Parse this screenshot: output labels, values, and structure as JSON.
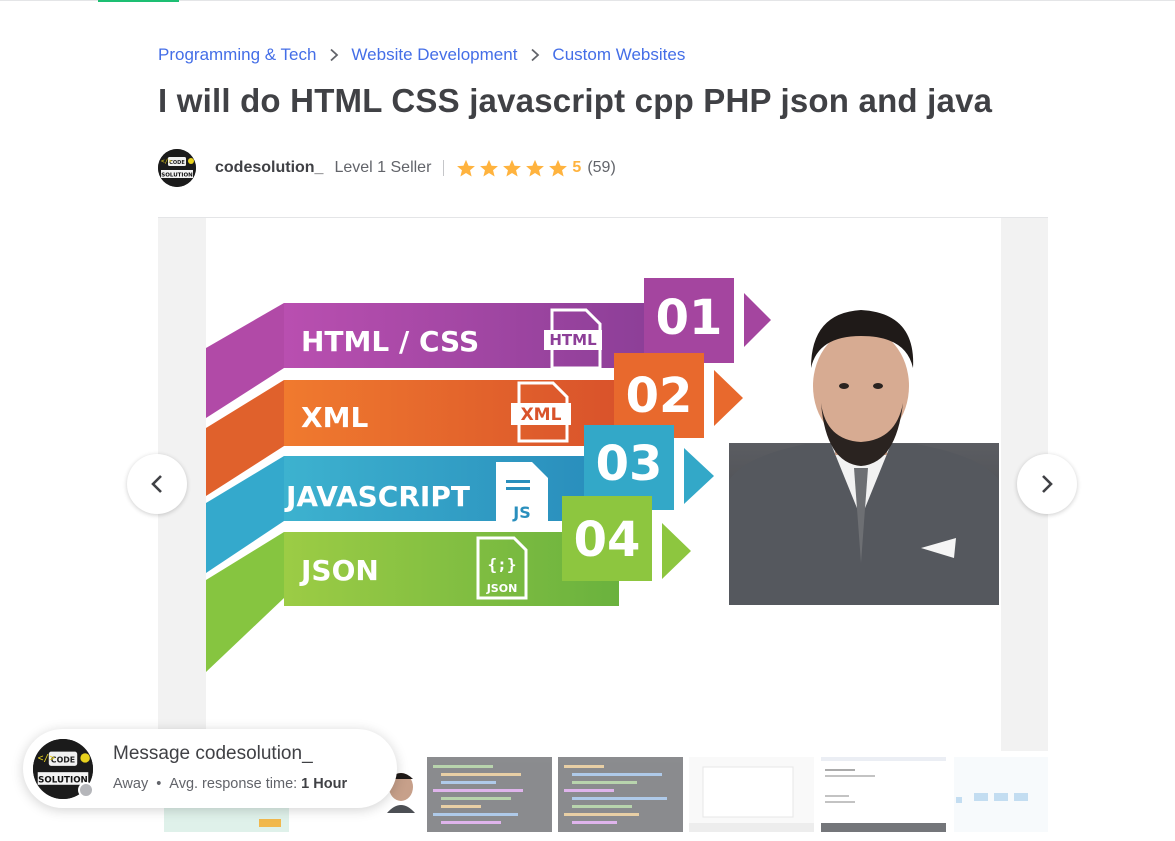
{
  "breadcrumb": [
    {
      "label": "Programming & Tech"
    },
    {
      "label": "Website Development"
    },
    {
      "label": "Custom Websites"
    }
  ],
  "gig": {
    "title": "I will do HTML CSS javascript cpp PHP json and java"
  },
  "seller": {
    "name": "codesolution_",
    "level": "Level 1 Seller",
    "rating": "5",
    "reviews": "(59)",
    "star_count": 5,
    "avatar_text_top": "CODE",
    "avatar_text_bottom": "SOLUTION"
  },
  "gallery": {
    "slide": {
      "rows": [
        {
          "label": "HTML / CSS",
          "number": "01",
          "icon_label": "HTML",
          "color": "#a64ca6"
        },
        {
          "label": "XML",
          "number": "02",
          "icon_label": "XML",
          "color": "#e8692d"
        },
        {
          "label": "JAVASCRIPT",
          "number": "03",
          "icon_label": "JS",
          "color": "#2fa5c6"
        },
        {
          "label": "JSON",
          "number": "04",
          "icon_label": "{;}",
          "icon_sub": "JSON",
          "color": "#8cc63f"
        }
      ]
    }
  },
  "chat": {
    "title": "Message codesolution_",
    "status": "Away",
    "response_label": "Avg. response time:",
    "response_value": "1 Hour"
  },
  "colors": {
    "brand_green": "#1dbf73",
    "link_blue": "#446ee7",
    "star": "#ffb33e",
    "text_dark": "#404145",
    "text_muted": "#62646a"
  },
  "icons": {
    "breadcrumb_separator": "chevron-right-icon",
    "prev": "chevron-left-icon",
    "next": "chevron-right-icon",
    "star": "star-icon",
    "presence": "away-status-icon"
  }
}
